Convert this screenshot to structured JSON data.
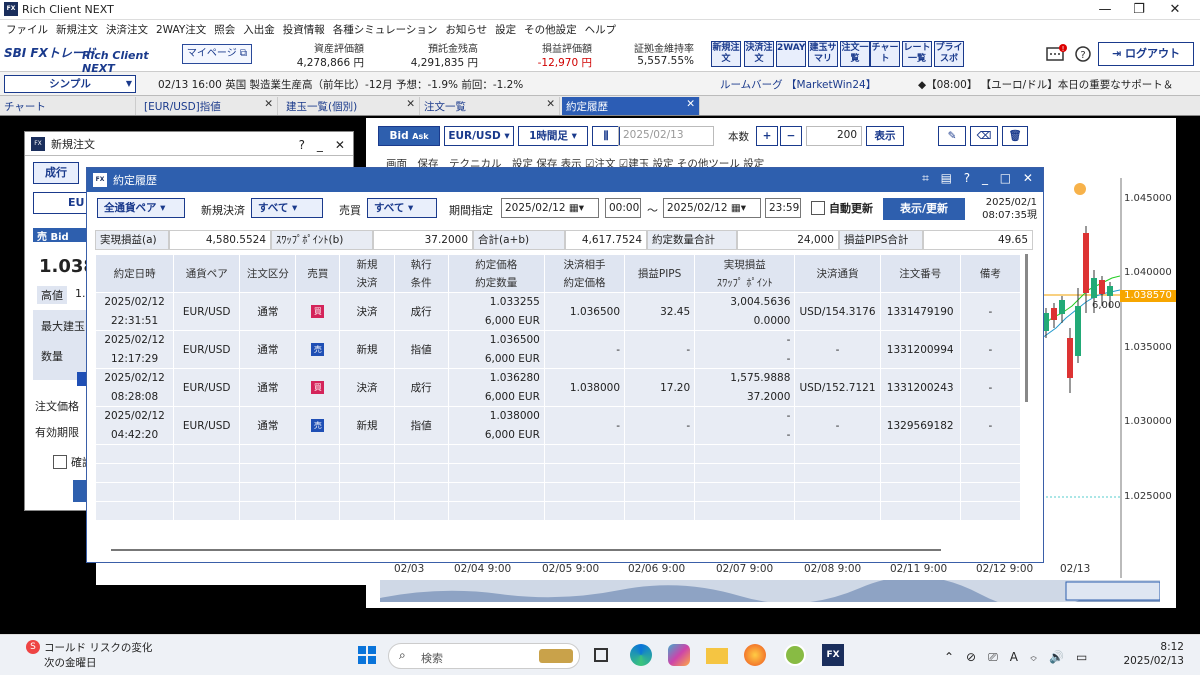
{
  "window": {
    "title": "Rich Client NEXT",
    "logo": "FX"
  },
  "menu": [
    "ファイル",
    "新規注文",
    "決済注文",
    "2WAY注文",
    "照会",
    "入出金",
    "投資情報",
    "各種シミュレーション",
    "お知らせ",
    "設定",
    "その他設定",
    "ヘルプ"
  ],
  "toolbar": {
    "brand_sbi": "SBI FXトレード",
    "brand_rc": "Rich Client NEXT",
    "mypage": "マイページ",
    "stats": [
      {
        "label": "資産評価額",
        "value": "4,278,866 円"
      },
      {
        "label": "預託金残高",
        "value": "4,291,835 円"
      },
      {
        "label": "損益評価額",
        "value": "-12,970 円"
      },
      {
        "label": "証拠金維持率",
        "value": "5,557.55%"
      }
    ],
    "buttons": [
      "新規注文",
      "決済注文",
      "2WAY",
      "建玉サマリ",
      "注文一覧",
      "チャート",
      "レート一覧",
      "プライスボ"
    ],
    "logout": "ログアウト"
  },
  "infobar": {
    "mode": "シンプル",
    "news1": "02/13 16:00 英国 製造業生産高（前年比）-12月 予想：-1.9% 前回：-1.2%",
    "news2": "ルームバーグ 【MarketWin24】",
    "news3": "◆【08:00】 【ユーロ/ドル】本日の重要なサポート＆"
  },
  "tabs": [
    "チャート",
    "[EUR/USD]指値",
    "建玉一覧(個別)",
    "注文一覧",
    "約定履歴"
  ],
  "chart": {
    "bid": "Bid",
    "ask": "Ask",
    "pair": "EUR/USD",
    "period": "1時間足",
    "date": "2025/02/13",
    "count_label": "本数",
    "count": "200",
    "show": "表示",
    "row2": [
      "画面",
      "保存",
      "テクニカル",
      "設定",
      "保存",
      "表示",
      "注文",
      "建玉",
      "設定",
      "その他ツール",
      "設定"
    ],
    "yticks": [
      "1.045000",
      "1.040000",
      "1.035000",
      "1.030000",
      "1.025000"
    ],
    "price": "1.038570",
    "pos_label": "6,000",
    "xticks": [
      "02/03",
      "02/04 9:00",
      "02/05 9:00",
      "02/06 9:00",
      "02/07 9:00",
      "02/08 9:00",
      "02/11 9:00",
      "02/12 9:00",
      "02/13"
    ]
  },
  "neworder": {
    "title": "新規注文",
    "tab": "成行",
    "pair": "EU",
    "bid_label": "売 Bid",
    "bid_value": "1.038",
    "high": "高値",
    "high_v": "1.",
    "max": "最大建玉",
    "qty": "数量",
    "price": "注文価格",
    "expiry": "有効期限",
    "confirm": "確認"
  },
  "dialog": {
    "title": "約定履歴",
    "filter": {
      "pair": "全通貨ペア",
      "kind_label": "新規決済",
      "kind": "すべて",
      "side_label": "売買",
      "side": "すべて",
      "period_label": "期間指定",
      "from_date": "2025/02/12",
      "from_time": "00:00",
      "tilde": "～",
      "to_date": "2025/02/12",
      "to_time": "23:59",
      "auto": "自動更新",
      "show": "表示/更新",
      "stamp1": "2025/02/1",
      "stamp2": "08:07:35現"
    },
    "summary": [
      {
        "label": "実現損益(a)",
        "value": "4,580.5524"
      },
      {
        "label": "ｽﾜｯﾌﾟﾎﾟｲﾝﾄ(b)",
        "value": "37.2000"
      },
      {
        "label": "合計(a+b)",
        "value": "4,617.7524"
      },
      {
        "label": "約定数量合計",
        "value": "24,000"
      },
      {
        "label": "損益PIPS合計",
        "value": "49.65"
      }
    ],
    "headers": [
      [
        "約定日時",
        ""
      ],
      [
        "通貨ペア",
        ""
      ],
      [
        "注文区分",
        ""
      ],
      [
        "売買",
        ""
      ],
      [
        "新規",
        "決済"
      ],
      [
        "執行",
        "条件"
      ],
      [
        "約定価格",
        "約定数量"
      ],
      [
        "決済相手",
        "約定価格"
      ],
      [
        "損益PIPS",
        ""
      ],
      [
        "実現損益",
        "ｽﾜｯﾌﾟ ﾎﾟｲﾝﾄ"
      ],
      [
        "決済通貨",
        ""
      ],
      [
        "注文番号",
        ""
      ],
      [
        "備考",
        ""
      ]
    ],
    "rows": [
      {
        "date": "2025/02/12",
        "time": "22:31:51",
        "pair": "EUR/USD",
        "type": "通常",
        "side": "買",
        "side_kind": "buy",
        "nk": "決済",
        "cond": "成行",
        "price": "1.033255",
        "qty": "6,000 EUR",
        "cp": "1.036500",
        "pips": "32.45",
        "pnl": "3,004.5636",
        "swap": "0.0000",
        "cur": "USD/154.3176",
        "no": "1331479190",
        "note": "-"
      },
      {
        "date": "2025/02/12",
        "time": "12:17:29",
        "pair": "EUR/USD",
        "type": "通常",
        "side": "売",
        "side_kind": "sell",
        "nk": "新規",
        "cond": "指値",
        "price": "1.036500",
        "qty": "6,000 EUR",
        "cp": "-",
        "pips": "-",
        "pnl": "-",
        "swap": "-",
        "cur": "-",
        "no": "1331200994",
        "note": "-"
      },
      {
        "date": "2025/02/12",
        "time": "08:28:08",
        "pair": "EUR/USD",
        "type": "通常",
        "side": "買",
        "side_kind": "buy",
        "nk": "決済",
        "cond": "成行",
        "price": "1.036280",
        "qty": "6,000 EUR",
        "cp": "1.038000",
        "pips": "17.20",
        "pnl": "1,575.9888",
        "swap": "37.2000",
        "cur": "USD/152.7121",
        "no": "1331200243",
        "note": "-"
      },
      {
        "date": "2025/02/12",
        "time": "04:42:20",
        "pair": "EUR/USD",
        "type": "通常",
        "side": "売",
        "side_kind": "sell",
        "nk": "新規",
        "cond": "指値",
        "price": "1.038000",
        "qty": "6,000 EUR",
        "cp": "-",
        "pips": "-",
        "pnl": "-",
        "swap": "-",
        "cur": "-",
        "no": "1329569182",
        "note": "-"
      }
    ]
  },
  "taskbar": {
    "weather1": "コールド リスクの変化",
    "weather2": "次の金曜日",
    "search": "検索",
    "time": "8:12",
    "date": "2025/02/13",
    "ime": "A"
  },
  "colors": {
    "accent": "#2e5fae",
    "buy": "#d4245a",
    "sell": "#1f4fb5",
    "loss": "#d00000"
  }
}
